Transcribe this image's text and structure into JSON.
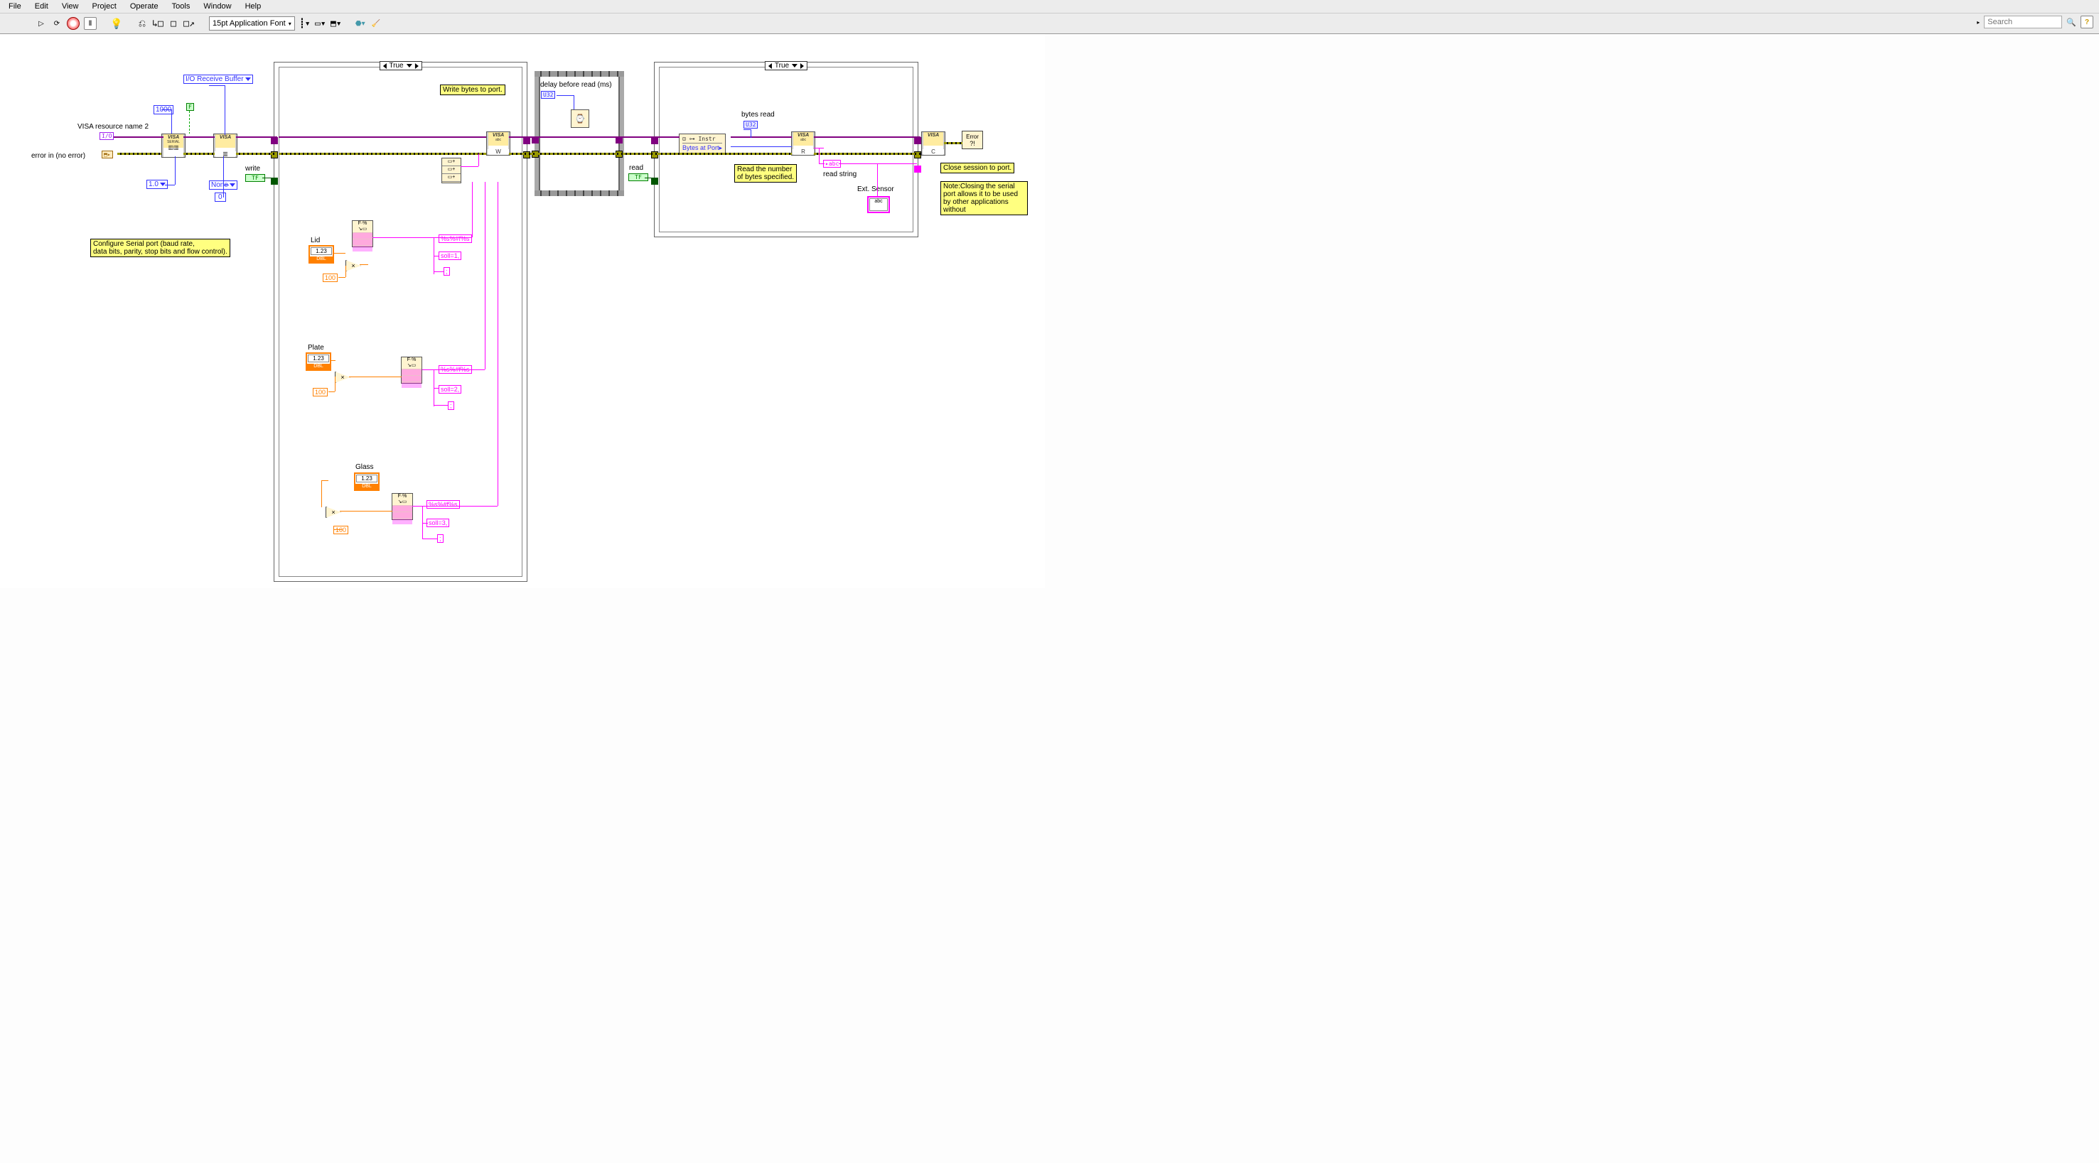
{
  "menu": {
    "file": "File",
    "edit": "Edit",
    "view": "View",
    "project": "Project",
    "operate": "Operate",
    "tools": "Tools",
    "window": "Window",
    "help": "Help"
  },
  "toolbar": {
    "font": "15pt Application Font",
    "search_placeholder": "Search"
  },
  "labels": {
    "visa_res": "VISA resource name 2",
    "error_in": "error in (no error)",
    "io_buffer": "I/O Receive Buffer",
    "thou": "1000",
    "v10": "1.0",
    "none": "None",
    "zero": "0",
    "write": "write",
    "read": "read",
    "delay": "delay before read (ms)",
    "bytes_read": "bytes read",
    "read_string": "read string",
    "ext_sensor": "Ext. Sensor",
    "lid": "Lid",
    "plate": "Plate",
    "glass": "Glass",
    "hundred": "100",
    "dbl": "1.23",
    "dbltag": "DBL"
  },
  "case": {
    "true": "True"
  },
  "fmt": {
    "pat": "%s%#f%s",
    "soll1": "soll=1,",
    "soll2": "soll=2,",
    "soll3": "soll=3,",
    "semi": ";"
  },
  "prop": {
    "header": "⊡ ⊶ Instr",
    "bytes": "Bytes at Port"
  },
  "tips": {
    "config": "Configure Serial port (baud rate,\ndata bits, parity, stop bits and flow control).",
    "write": "Write bytes to port.",
    "readnum": "Read the number\nof bytes specified.",
    "close": "Close session to port.",
    "noteclose": "Note:Closing the serial\nport allows it to be used\nby other applications\nwithout"
  },
  "term": {
    "io": "I/O",
    "u32": "U32",
    "abc": "abc",
    "tf": "TF",
    "abc_arrow": "▸abc"
  },
  "visa": {
    "top": "VISA",
    "serial": "SERIAL",
    "w": "W",
    "r": "R",
    "c": "C",
    "abc": "abc"
  }
}
